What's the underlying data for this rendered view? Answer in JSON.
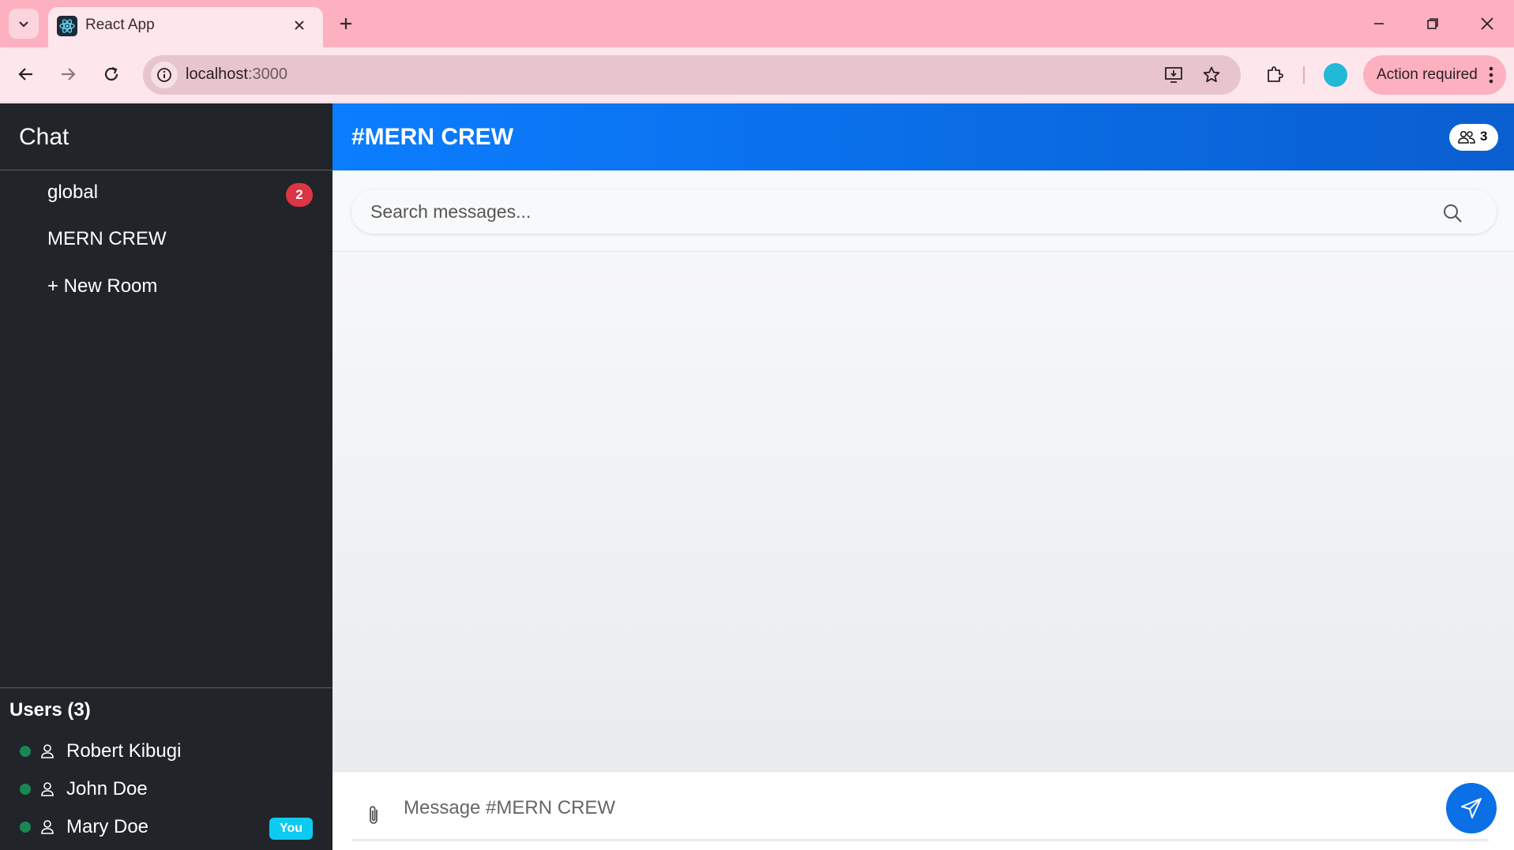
{
  "browser": {
    "tab_title": "React App",
    "url_host": "localhost",
    "url_port": ":3000",
    "action_required_label": "Action required"
  },
  "sidebar": {
    "title": "Chat",
    "rooms": [
      {
        "label": "global",
        "unread": "2"
      },
      {
        "label": "MERN CREW"
      }
    ],
    "new_room_label": "+ New Room",
    "users_title": "Users (3)",
    "users": [
      {
        "name": "Robert Kibugi",
        "status": "online"
      },
      {
        "name": "John Doe",
        "status": "online"
      },
      {
        "name": "Mary Doe",
        "status": "online",
        "badge": "You"
      }
    ]
  },
  "main": {
    "room_title": "#MERN CREW",
    "member_count": "3",
    "search": {
      "placeholder": "Search messages...",
      "value": ""
    },
    "composer": {
      "placeholder": "Message #MERN CREW",
      "value": ""
    }
  },
  "colors": {
    "header_gradient_start": "#0b7dff",
    "header_gradient_end": "#0a5fd0",
    "sidebar_bg": "#212529",
    "unread_badge": "#dc3545",
    "online": "#198754",
    "you_badge": "#0dcaf0",
    "send_button": "#0b6fe6",
    "browser_frame": "#fcb0c0"
  },
  "icons": {
    "tab_search": "chevron-down-icon",
    "favicon": "react-atom-icon",
    "tab_close": "close-icon",
    "new_tab": "plus-icon",
    "back": "arrow-left-icon",
    "forward": "arrow-right-icon",
    "reload": "reload-icon",
    "site_info": "info-icon",
    "install": "install-app-icon",
    "bookmark": "star-icon",
    "extensions": "puzzle-icon",
    "members": "users-icon",
    "search": "search-icon",
    "attach": "paperclip-icon",
    "send": "send-icon",
    "user": "person-icon"
  }
}
